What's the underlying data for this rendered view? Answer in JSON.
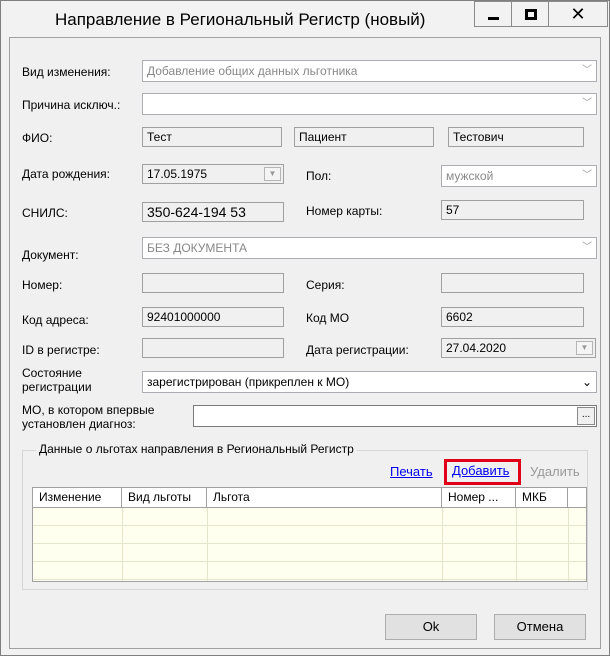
{
  "window": {
    "title": "Направление в Региональный Регистр (новый)",
    "controls": {
      "minimize": "minimize-icon",
      "maximize": "maximize-icon",
      "close": "close-icon"
    }
  },
  "form": {
    "change_type": {
      "label": "Вид изменения:",
      "value": "Добавление общих данных льготника"
    },
    "exclusion_reason": {
      "label": "Причина исключ.:",
      "value": ""
    },
    "fio": {
      "label": "ФИО:",
      "last_name": "Тест",
      "first_name": "Пациент",
      "middle_name": "Тестович"
    },
    "birth_date": {
      "label": "Дата рождения:",
      "value": "17.05.1975"
    },
    "sex": {
      "label": "Пол:",
      "value": "мужской"
    },
    "snils": {
      "label": "СНИЛС:",
      "value": "350-624-194 53"
    },
    "card_number": {
      "label": "Номер карты:",
      "value": "57"
    },
    "document": {
      "label": "Документ:",
      "value": "БЕЗ ДОКУМЕНТА"
    },
    "doc_number": {
      "label": "Номер:",
      "value": ""
    },
    "doc_series": {
      "label": "Серия:",
      "value": ""
    },
    "address_code": {
      "label": "Код адреса:",
      "value": "92401000000"
    },
    "mo_code": {
      "label": "Код МО",
      "value": "6602"
    },
    "registry_id": {
      "label": "ID в регистре:",
      "value": ""
    },
    "registration_date": {
      "label": "Дата регистрации:",
      "value": "27.04.2020"
    },
    "registration_state": {
      "label_line1": "Состояние",
      "label_line2": "регистрации",
      "value": "зарегистрирован (прикреплен к МО)"
    },
    "first_diagnosis_mo": {
      "label_line1": "МО, в котором впервые",
      "label_line2": "установлен диагноз:",
      "value": "",
      "button": "..."
    }
  },
  "benefits": {
    "group_title": "Данные о льготах направления в Региональный Регистр",
    "actions": {
      "print": "Печать",
      "add": "Добавить",
      "delete": "Удалить"
    },
    "columns": [
      "Изменение",
      "Вид льготы",
      "Льгота",
      "Номер ...",
      "МКБ"
    ],
    "rows": []
  },
  "footer": {
    "ok": "Ok",
    "cancel": "Отмена"
  },
  "colors": {
    "highlight": "#e0001a",
    "link": "#0000ee",
    "grid_bg": "#fffff0"
  }
}
